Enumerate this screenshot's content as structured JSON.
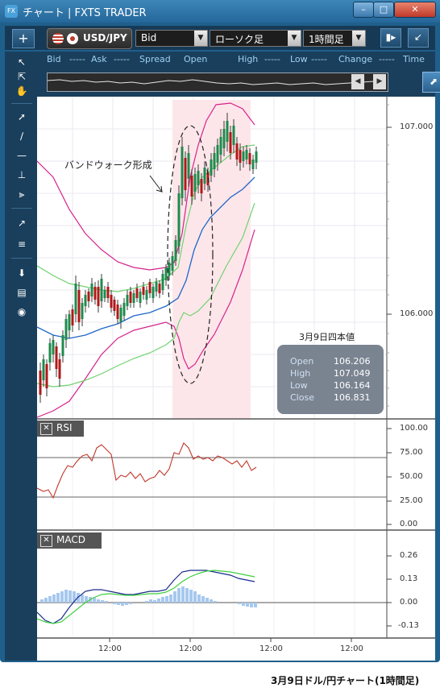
{
  "window": {
    "title": "チャート | FXTS TRADER",
    "app_icon": "FX",
    "buttons": [
      "min",
      "max",
      "close"
    ]
  },
  "toolbar": {
    "add_label": "+",
    "symbol": "USD/JPY",
    "price_type": "Bid",
    "chart_type": "ローソク足",
    "timeframe": "1時間足"
  },
  "quote_header": {
    "labels": [
      "Bid",
      "-----",
      "Ask",
      "-----",
      "Spread",
      "Open",
      "High",
      "-----",
      "Low",
      "-----",
      "Change",
      "-----",
      "Time"
    ]
  },
  "annotation": {
    "text": "バンドウォーク形成"
  },
  "ohlc_box": {
    "title": "3月9日四本値",
    "rows": [
      {
        "label": "Open",
        "value": "106.206"
      },
      {
        "label": "High",
        "value": "107.049"
      },
      {
        "label": "Low",
        "value": "106.164"
      },
      {
        "label": "Close",
        "value": "106.831"
      }
    ]
  },
  "price_axis": {
    "labels": [
      "107.000",
      "106.000"
    ]
  },
  "rsi_panel": {
    "name": "RSI",
    "axis": [
      "100.00",
      "75.00",
      "50.00",
      "25.00",
      "0.00"
    ]
  },
  "macd_panel": {
    "name": "MACD",
    "axis": [
      "0.26",
      "0.13",
      "0.00",
      "-0.13"
    ]
  },
  "time_axis": {
    "labels": [
      "12:00",
      "12:00",
      "12:00",
      "12:00"
    ]
  },
  "caption": "3月9日ドル/円チャート(1時間足)",
  "colors": {
    "window": "#1f5f8c",
    "highlight": "#fde6ea",
    "bollinger_outer": "#d6238c",
    "bollinger_inner": "#6fd36f",
    "ma": "#1f67c7",
    "rsi": "#c0392b",
    "macd": "#1a2a8c",
    "signal": "#3ecf3e",
    "histogram": "#a6c8ee"
  },
  "chart_data": {
    "type": "line",
    "price_axis_labels": [
      107.0,
      106.0
    ],
    "ohlc_march9": {
      "open": 106.206,
      "high": 107.049,
      "low": 106.164,
      "close": 106.831
    },
    "rsi_levels": [
      70,
      30
    ],
    "macd_zero": 0
  }
}
